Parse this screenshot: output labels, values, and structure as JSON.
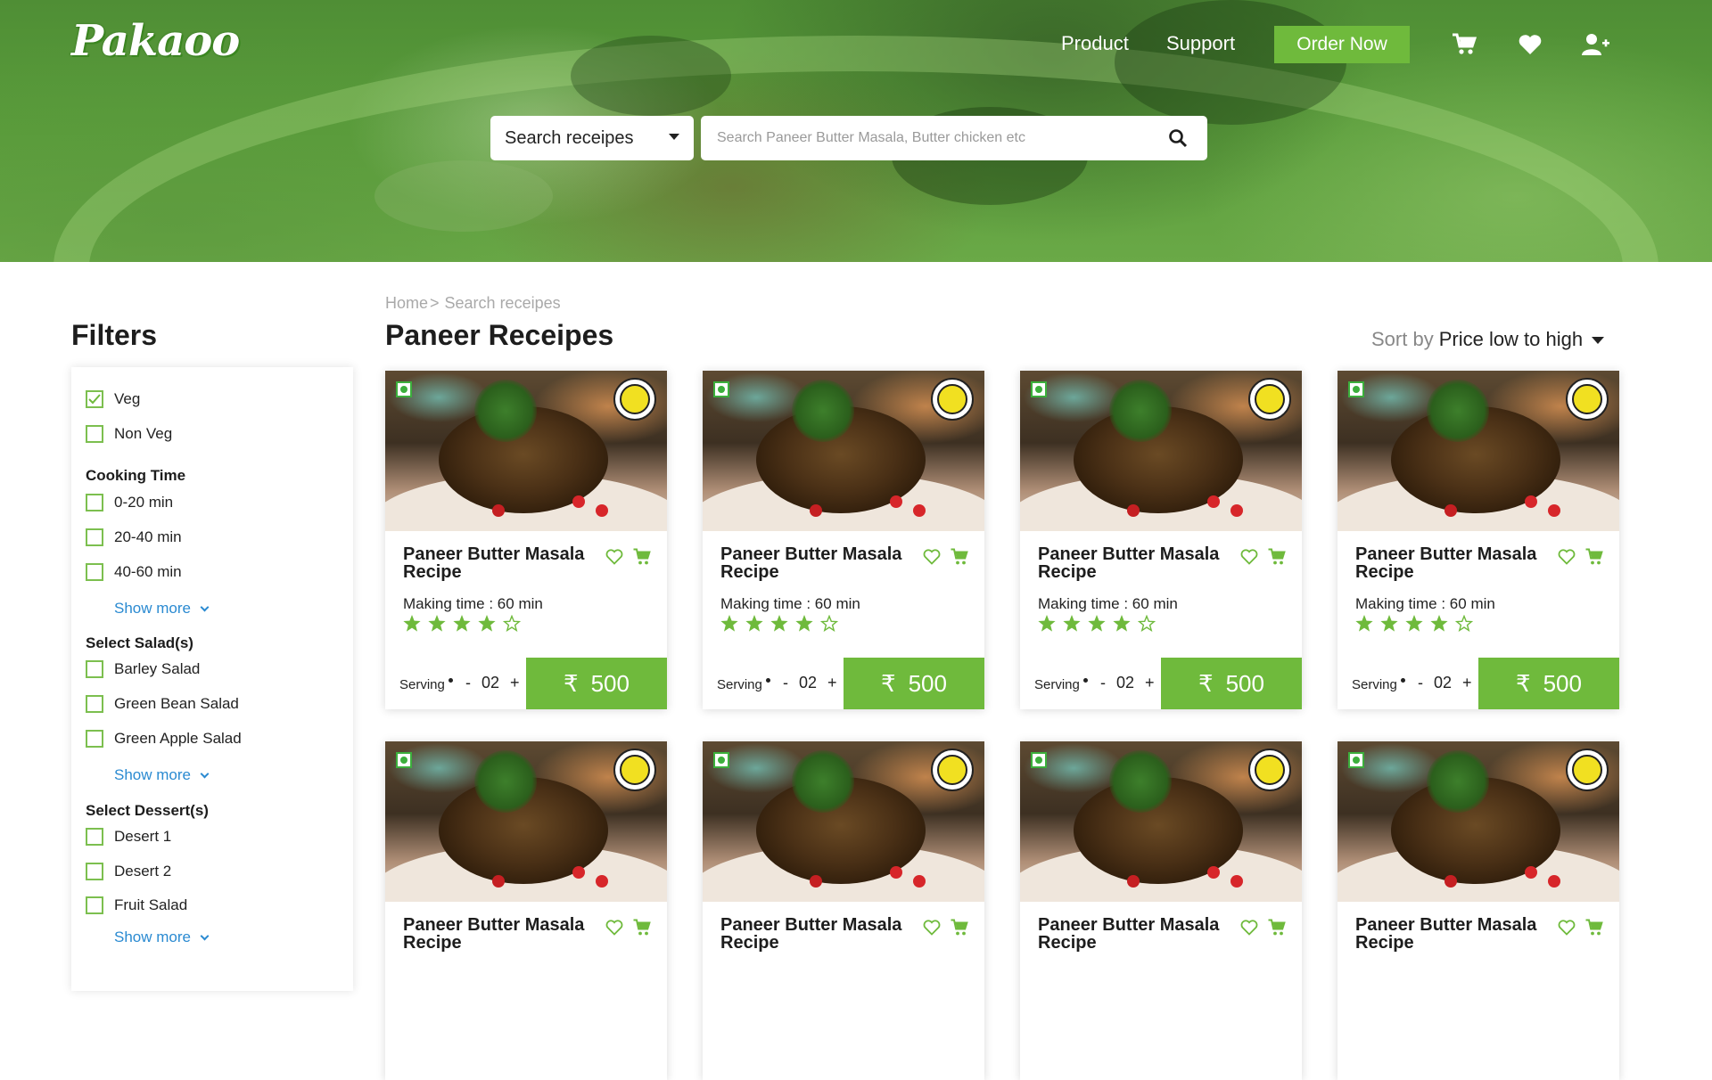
{
  "brand": {
    "logo_text": "Pakaoo"
  },
  "nav": {
    "product": "Product",
    "support": "Support",
    "order_now": "Order Now"
  },
  "search": {
    "category": "Search receipes",
    "placeholder": "Search Paneer Butter Masala, Butter chicken etc"
  },
  "breadcrumb": {
    "home": "Home",
    "sep": ">",
    "current": "Search receipes"
  },
  "filters": {
    "title": "Filters",
    "diet": [
      {
        "label": "Veg",
        "checked": true
      },
      {
        "label": "Non Veg",
        "checked": false
      }
    ],
    "cooking_time": {
      "title": "Cooking Time",
      "options": [
        "0-20 min",
        "20-40 min",
        "40-60 min"
      ]
    },
    "salads": {
      "title": "Select Salad(s)",
      "options": [
        "Barley Salad",
        "Green Bean Salad",
        "Green Apple Salad"
      ]
    },
    "desserts": {
      "title": "Select Dessert(s)",
      "options": [
        "Desert 1",
        "Desert 2",
        "Fruit Salad"
      ]
    },
    "show_more": "Show more"
  },
  "main": {
    "title": "Paneer Receipes",
    "sort_label": "Sort by",
    "sort_value": "Price low to high"
  },
  "cards": [
    {
      "title": "Paneer Butter Masala Recipe",
      "making": "Making time : 60 min",
      "rating": 4,
      "serving_label": "Serving",
      "minus": "-",
      "qty": "02",
      "plus": "+",
      "currency": "₹",
      "price": "500"
    },
    {
      "title": "Paneer Butter Masala Recipe",
      "making": "Making time : 60 min",
      "rating": 4,
      "serving_label": "Serving",
      "minus": "-",
      "qty": "02",
      "plus": "+",
      "currency": "₹",
      "price": "500"
    },
    {
      "title": "Paneer Butter Masala Recipe",
      "making": "Making time : 60 min",
      "rating": 4,
      "serving_label": "Serving",
      "minus": "-",
      "qty": "02",
      "plus": "+",
      "currency": "₹",
      "price": "500"
    },
    {
      "title": "Paneer Butter Masala Recipe",
      "making": "Making time : 60 min",
      "rating": 4,
      "serving_label": "Serving",
      "minus": "-",
      "qty": "02",
      "plus": "+",
      "currency": "₹",
      "price": "500"
    },
    {
      "title": "Paneer Butter Masala Recipe"
    },
    {
      "title": "Paneer Butter Masala Recipe"
    },
    {
      "title": "Paneer Butter Masala Recipe"
    },
    {
      "title": "Paneer Butter Masala Recipe"
    }
  ],
  "colors": {
    "accent": "#6fba3c",
    "link": "#2a8ad1"
  }
}
